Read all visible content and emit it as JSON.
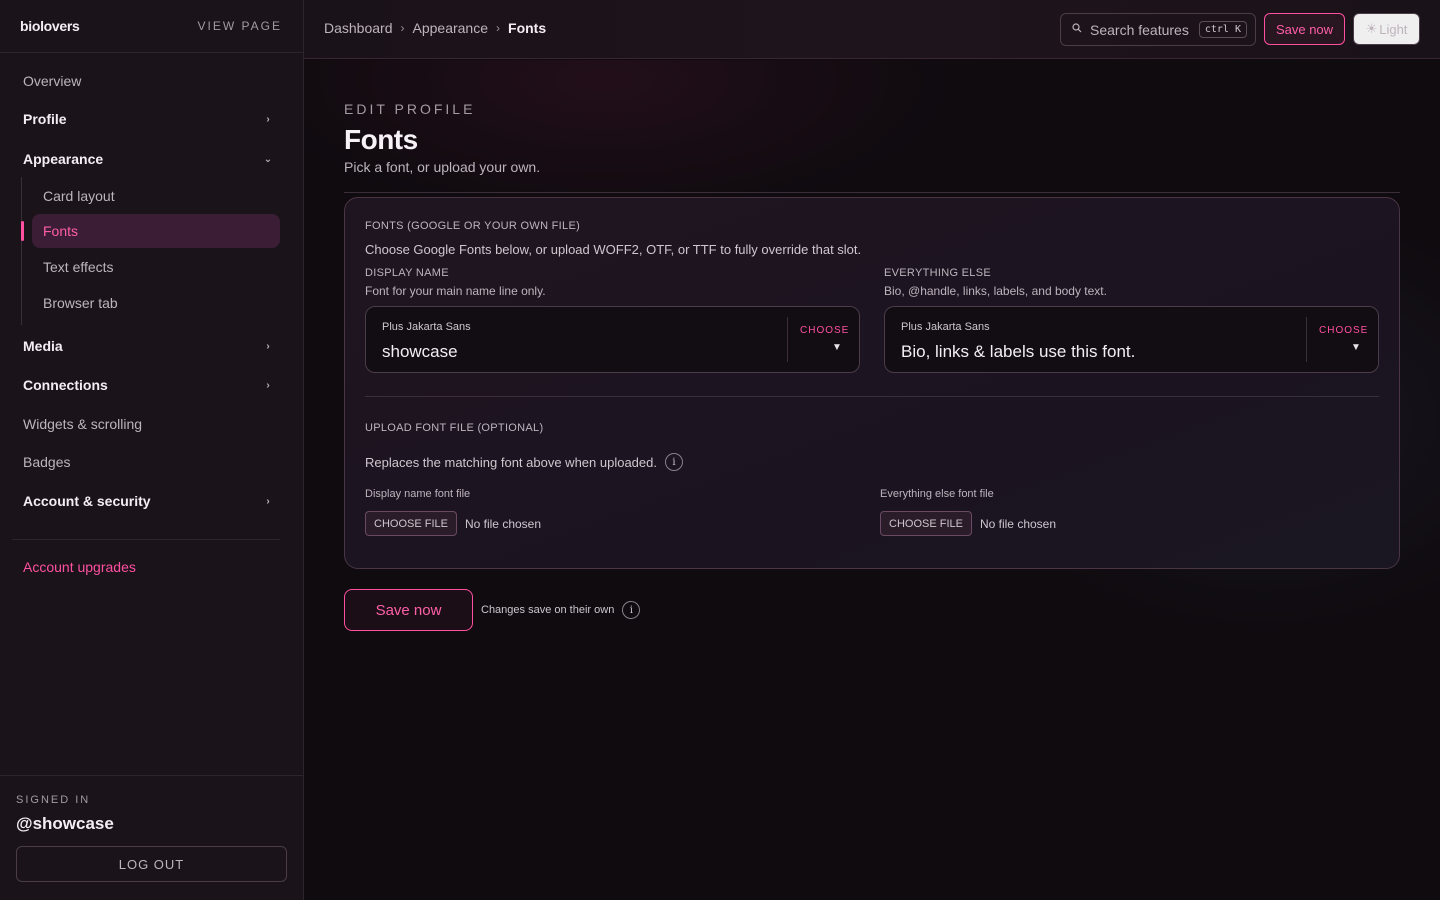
{
  "brand": "biolovers",
  "view_page": "VIEW PAGE",
  "sidebar": {
    "items": [
      {
        "label": "Overview"
      },
      {
        "label": "Profile",
        "chevron": "›"
      },
      {
        "label": "Appearance",
        "chevron": "⌄"
      },
      {
        "label": "Media",
        "chevron": "›"
      },
      {
        "label": "Connections",
        "chevron": "›"
      },
      {
        "label": "Widgets & scrolling"
      },
      {
        "label": "Badges"
      },
      {
        "label": "Account & security",
        "chevron": "›"
      }
    ],
    "appearance_sub": [
      {
        "label": "Card layout"
      },
      {
        "label": "Fonts",
        "active": true
      },
      {
        "label": "Text effects"
      },
      {
        "label": "Browser tab"
      }
    ],
    "upgrades": "Account upgrades",
    "signed_in_label": "SIGNED IN",
    "handle": "@showcase",
    "logout": "LOG OUT"
  },
  "topbar": {
    "breadcrumb": [
      "Dashboard",
      "Appearance",
      "Fonts"
    ],
    "breadcrumb_sep": "›",
    "search_placeholder": "Search features",
    "search_shortcut": "ctrl K",
    "save_label": "Save now",
    "theme_label": "Light",
    "theme_icon": "☀"
  },
  "page": {
    "eyebrow": "EDIT PROFILE",
    "title": "Fonts",
    "subtitle": "Pick a font, or upload your own."
  },
  "fonts_card": {
    "heading": "FONTS (GOOGLE OR YOUR OWN FILE)",
    "description": "Choose Google Fonts below, or upload WOFF2, OTF, or TTF to fully override that slot.",
    "display": {
      "heading": "DISPLAY NAME",
      "description": "Font for your main name line only.",
      "font_name": "Plus Jakarta Sans",
      "sample": "showcase",
      "choose": "CHOOSE"
    },
    "body": {
      "heading": "EVERYTHING ELSE",
      "description": "Bio, @handle, links, labels, and body text.",
      "font_name": "Plus Jakarta Sans",
      "sample": "Bio, links & labels use this font.",
      "choose": "CHOOSE"
    },
    "upload": {
      "heading": "UPLOAD FONT FILE (OPTIONAL)",
      "description": "Replaces the matching font above when uploaded.",
      "display_label": "Display name font file",
      "body_label": "Everything else font file",
      "button": "CHOOSE FILE",
      "status": "No file chosen"
    }
  },
  "footer": {
    "save_label": "Save now",
    "note": "Changes save on their own"
  },
  "colors": {
    "accent": "#ff4fa0",
    "sidebar_bg": "#1a141a",
    "active_bg": "#3b1d35"
  }
}
